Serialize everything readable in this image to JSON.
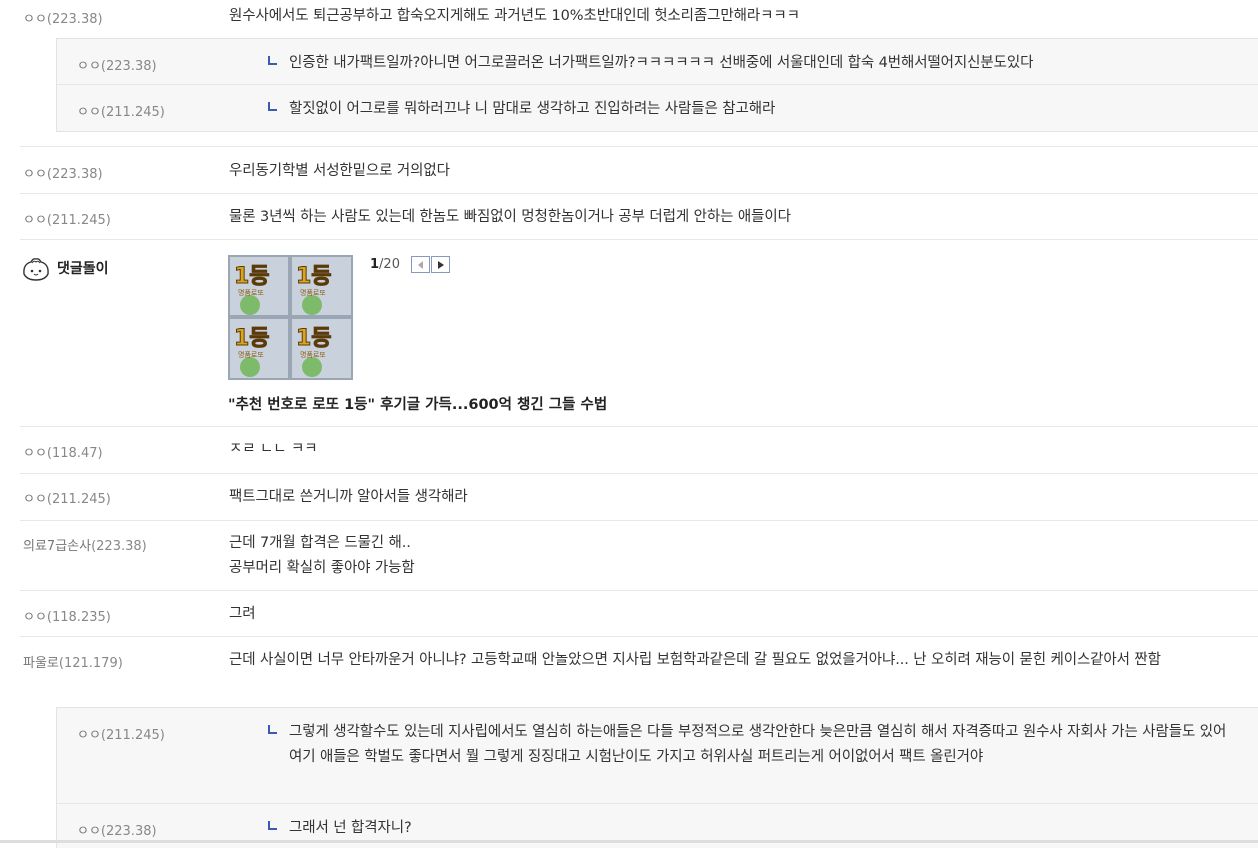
{
  "comments": [
    {
      "nick": "ㅇㅇ",
      "ip": "(223.38)",
      "text": "원수사에서도 퇴근공부하고 합숙오지게해도 과거년도 10%초반대인데 헛소리좀그만해라ㅋㅋㅋ"
    },
    {
      "nick": "ㅇㅇ",
      "ip": "(223.38)",
      "text": "인증한 내가팩트일까?아니면 어그로끌러온 너가팩트일까?ㅋㅋㅋㅋㅋㅋ 선배중에 서울대인데 합숙 4번해서떨어지신분도있다"
    },
    {
      "nick": "ㅇㅇ",
      "ip": "(211.245)",
      "text": "할짓없이 어그로를 뭐하러끄냐 니 맘대로 생각하고 진입하려는 사람들은 참고해라"
    },
    {
      "nick": "ㅇㅇ",
      "ip": "(223.38)",
      "text": "우리동기학별 서성한밑으로 거의없다"
    },
    {
      "nick": "ㅇㅇ",
      "ip": "(211.245)",
      "text": "물론 3년씩 하는 사람도 있는데 한놈도 빠짐없이 멍청한놈이거나 공부 더럽게 안하는 애들이다"
    },
    {
      "nick": "ㅇㅇ",
      "ip": "(118.47)",
      "text": "ㅈㄹ ㄴㄴ ㅋㅋ"
    },
    {
      "nick": "ㅇㅇ",
      "ip": "(211.245)",
      "text": "팩트그대로 쓴거니까 알아서들 생각해라"
    },
    {
      "nick": "의료7급손사",
      "ip": "(223.38)",
      "text": "근데 7개월 합격은 드물긴 해..",
      "text2": "공부머리 확실히 좋아야 가능함"
    },
    {
      "nick": "ㅇㅇ",
      "ip": "(118.235)",
      "text": "그려"
    },
    {
      "nick": "파울로",
      "ip": "(121.179)",
      "text": "근데 사실이면 너무 안타까운거 아니냐? 고등학교때 안놀았으면 지사립 보험학과같은데 갈 필요도 없었을거아냐... 난 오히려 재능이 묻힌 케이스같아서 짠함"
    },
    {
      "nick": "ㅇㅇ",
      "ip": "(211.245)",
      "text": "그렇게 생각할수도 있는데 지사립에서도 열심히 하는애들은 다들 부정적으로 생각안한다 늦은만큼 열심히 해서 자격증따고 원수사 자회사 가는 사람들도 있어 여기 애들은 학벌도 좋다면서 뭘 그렇게 징징대고 시험난이도 가지고 허위사실 퍼트리는게 어이없어서 팩트 올린거야"
    },
    {
      "nick": "ㅇㅇ",
      "ip": "(223.38)",
      "text": "그래서 넌 합격자니?"
    }
  ],
  "ad": {
    "bot_name": "댓글돌이",
    "page_current": "1",
    "page_total": "/20",
    "title": "\"추천 번호로 로또 1등\" 후기글 가득...600억 챙긴 그들 수법",
    "thumb_label": "1등",
    "thumb_sub": "명품로또"
  },
  "colors": {
    "reply_bg": "#f7f7f7",
    "arrow": "#3a5bb0",
    "pager_border": "#8a98bb"
  }
}
